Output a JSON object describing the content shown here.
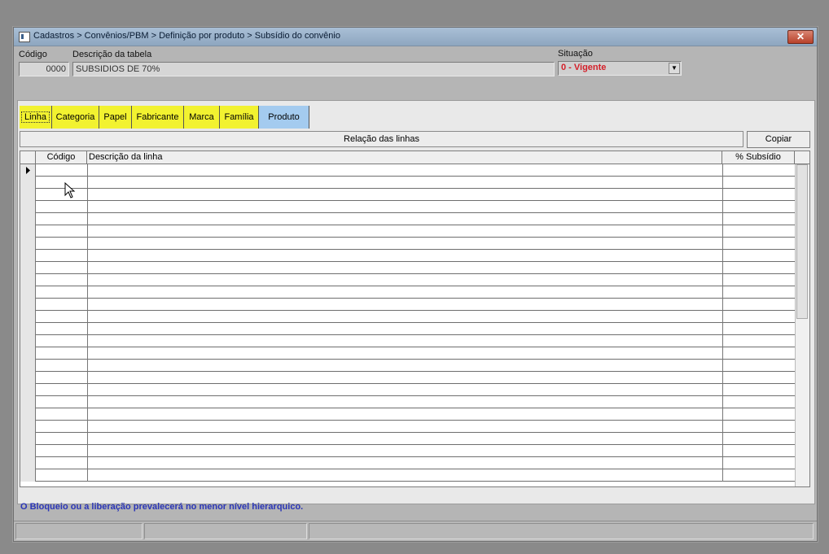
{
  "window": {
    "title": "Cadastros > Convênios/PBM > Definição por produto > Subsídio do convênio",
    "close_label": "✕"
  },
  "form": {
    "codigo_label": "Código",
    "codigo_value": "0000",
    "descricao_label": "Descrição da tabela",
    "descricao_value": "SUBSIDIOS DE 70%",
    "situacao_label": "Situação",
    "situacao_value": "0 - Vigente"
  },
  "tabs": [
    {
      "label": "Linha",
      "active": true,
      "highlight": "yellow"
    },
    {
      "label": "Categoria",
      "active": false,
      "highlight": "yellow"
    },
    {
      "label": "Papel",
      "active": false,
      "highlight": "yellow"
    },
    {
      "label": "Fabricante",
      "active": false,
      "highlight": "yellow"
    },
    {
      "label": "Marca",
      "active": false,
      "highlight": "yellow"
    },
    {
      "label": "Família",
      "active": false,
      "highlight": "yellow"
    },
    {
      "label": "Produto",
      "active": false,
      "highlight": "blue"
    }
  ],
  "section": {
    "title": "Relação das linhas",
    "copy_label": "Copiar"
  },
  "grid": {
    "columns": [
      "Código",
      "Descrição da linha",
      "% Subsídio"
    ],
    "row_count": 26
  },
  "footer_note": "O Bloqueio ou a liberação prevalecerá no menor nível hierarquico.",
  "colors": {
    "tab_yellow": "#f2f230",
    "tab_blue": "#a4cbef",
    "situacao_red": "#d4202a",
    "footer_blue": "#2b36b8"
  }
}
